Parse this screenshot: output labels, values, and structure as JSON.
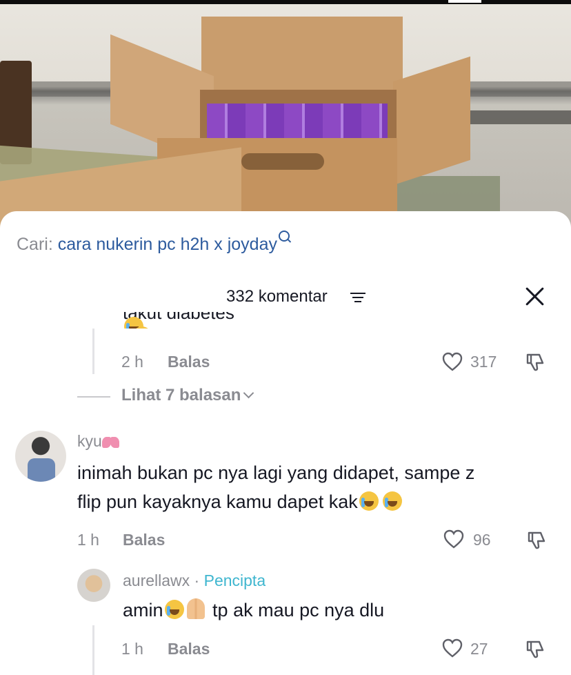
{
  "search": {
    "label": "Cari:",
    "query": "cara nukerin pc h2h x joyday"
  },
  "header": {
    "comment_count": "332 komentar"
  },
  "previous_reply": {
    "text_cutoff": "takut diabetes",
    "time": "2 h",
    "reply_label": "Balas",
    "likes": "317"
  },
  "view_replies": {
    "label": "Lihat 7 balasan"
  },
  "comments": [
    {
      "username": "kyu",
      "text_line1": "inimah bukan pc nya lagi yang didapet, sampe z",
      "text_line2": "flip pun kayaknya kamu dapet kak",
      "time": "1 h",
      "reply_label": "Balas",
      "likes": "96"
    },
    {
      "username": "aurellawx",
      "separator": "·",
      "badge": "Pencipta",
      "text_start": "amin",
      "text_end": "tp ak mau pc nya dlu",
      "time": "1 h",
      "reply_label": "Balas",
      "likes": "27"
    }
  ],
  "colors": {
    "search_query": "#2d5b9e",
    "author_badge": "#3fb6cf",
    "meta_gray": "#8a8b91",
    "text_dark": "#161823"
  }
}
